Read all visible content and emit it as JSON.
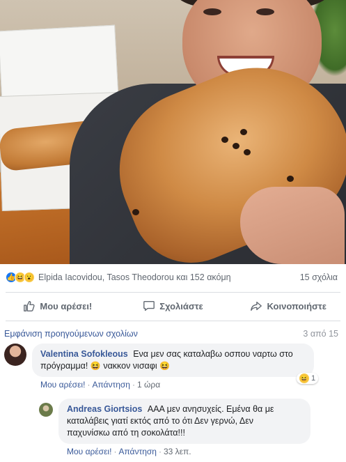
{
  "post": {
    "photo_alt": "Man holding a giant chocolate croissant",
    "reactions": {
      "icons": [
        "like-icon",
        "haha-icon",
        "wow-icon"
      ],
      "names": "Elpida Iacovidou, Tasos Theodorou και 152 ακόμη",
      "comments_count": "15 σχόλια"
    },
    "actions": {
      "like": "Μου αρέσει!",
      "comment": "Σχολιάστε",
      "share": "Κοινοποιήστε"
    }
  },
  "comments": {
    "prev_link": "Εμφάνιση προηγούμενων σχολίων",
    "count": "3 από 15",
    "items": [
      {
        "author": "Valentina Sofokleous",
        "text_line1": "Ενα μεν σας καταλαβω οσπου ναρτω στο",
        "text_line2": "πρόγραμμα!",
        "text_mid": "νακκον νισαφι",
        "emoji": "😆",
        "like": "Μου αρέσει!",
        "reply": "Απάντηση",
        "time": "1 ώρα",
        "reaction_count": "1"
      },
      {
        "author": "Andreas Giortsios",
        "text_line1": "ΑΑΑ μεν ανησυχείς. Εμένα θα με",
        "text_line2": "καταλάβεις γιατί εκτός από το ότι Δεν γερνώ, Δεν",
        "text_line3": "παχυνίσκω από τη σοκολάτα!!!",
        "like": "Μου αρέσει!",
        "reply": "Απάντηση",
        "time": "33 λεπ."
      }
    ]
  },
  "colors": {
    "link": "#385898",
    "muted": "#606770",
    "bubble": "#f2f3f5",
    "like_blue": "#1877f2"
  }
}
